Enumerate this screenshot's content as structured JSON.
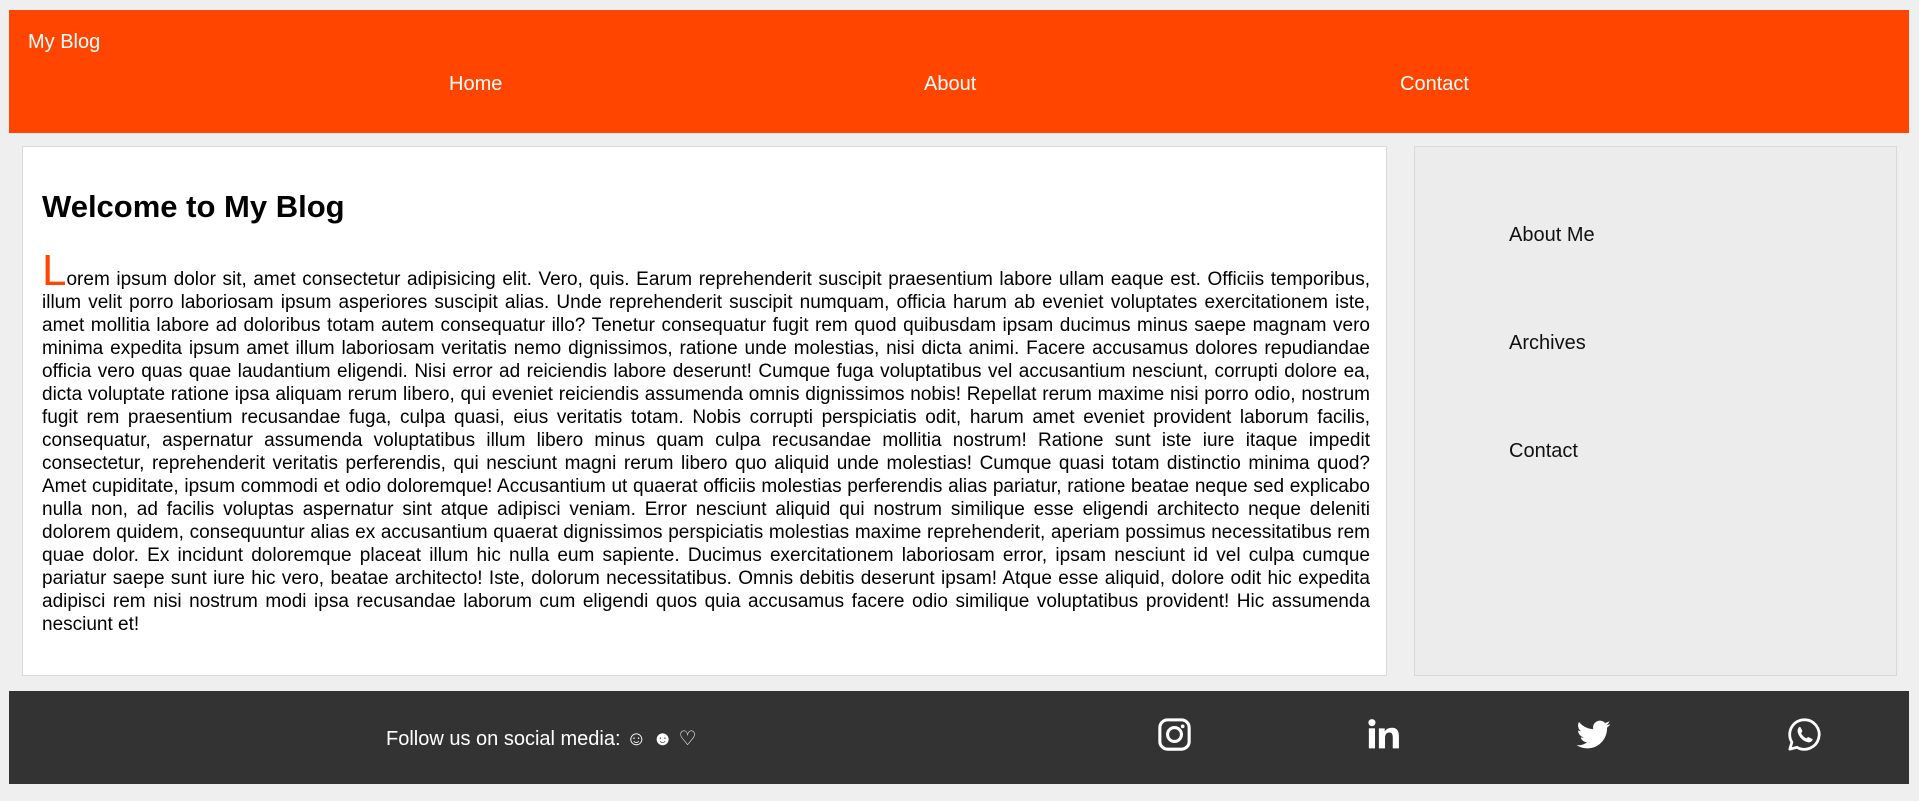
{
  "header": {
    "title": "My Blog",
    "nav": {
      "home": "Home",
      "about": "About",
      "contact": "Contact"
    }
  },
  "post": {
    "title": "Welcome to My Blog",
    "first_letter": "L",
    "body_rest": "orem ipsum dolor sit, amet consectetur adipisicing elit. Vero, quis. Earum reprehenderit suscipit praesentium labore ullam eaque est. Officiis temporibus, illum velit porro laboriosam ipsum asperiores suscipit alias. Unde reprehenderit suscipit numquam, officia harum ab eveniet voluptates exercitationem iste, amet mollitia labore ad doloribus totam autem consequatur illo? Tenetur consequatur fugit rem quod quibusdam ipsam ducimus minus saepe magnam vero minima expedita ipsum amet illum laboriosam veritatis nemo dignissimos, ratione unde molestias, nisi dicta animi. Facere accusamus dolores repudiandae officia vero quas quae laudantium eligendi. Nisi error ad reiciendis labore deserunt! Cumque fuga voluptatibus vel accusantium nesciunt, corrupti dolore ea, dicta voluptate ratione ipsa aliquam rerum libero, qui eveniet reiciendis assumenda omnis dignissimos nobis! Repellat rerum maxime nisi porro odio, nostrum fugit rem praesentium recusandae fuga, culpa quasi, eius veritatis totam. Nobis corrupti perspiciatis odit, harum amet eveniet provident laborum facilis, consequatur, aspernatur assumenda voluptatibus illum libero minus quam culpa recusandae mollitia nostrum! Ratione sunt iste iure itaque impedit consectetur, reprehenderit veritatis perferendis, qui nesciunt magni rerum libero quo aliquid unde molestias! Cumque quasi totam distinctio minima quod? Amet cupiditate, ipsum commodi et odio doloremque! Accusantium ut quaerat officiis molestias perferendis alias pariatur, ratione beatae neque sed explicabo nulla non, ad facilis voluptas aspernatur sint atque adipisci veniam. Error nesciunt aliquid qui nostrum similique esse eligendi architecto neque deleniti dolorem quidem, consequuntur alias ex accusantium quaerat dignissimos perspiciatis molestias maxime reprehenderit, aperiam possimus necessitatibus rem quae dolor. Ex incidunt doloremque placeat illum hic nulla eum sapiente. Ducimus exercitationem laboriosam error, ipsam nesciunt id vel culpa cumque pariatur saepe sunt iure hic vero, beatae architecto! Iste, dolorum necessitatibus. Omnis debitis deserunt ipsam! Atque esse aliquid, dolore odit hic expedita adipisci rem nisi nostrum modi ipsa recusandae laborum cum eligendi quos quia accusamus facere odio similique voluptatibus provident! Hic assumenda nesciunt et!"
  },
  "sidebar": {
    "items": [
      {
        "label": "About Me"
      },
      {
        "label": "Archives"
      },
      {
        "label": "Contact"
      }
    ]
  },
  "footer": {
    "follow_text": "Follow us on social media: ☺ ☻ ♡",
    "social_icons": [
      "instagram-icon",
      "linkedin-icon",
      "twitter-icon",
      "whatsapp-icon"
    ]
  },
  "colors": {
    "header_bg": "#ff4500",
    "footer_bg": "#333333",
    "sidebar_bg": "#ececec",
    "accent": "#ff4500"
  }
}
